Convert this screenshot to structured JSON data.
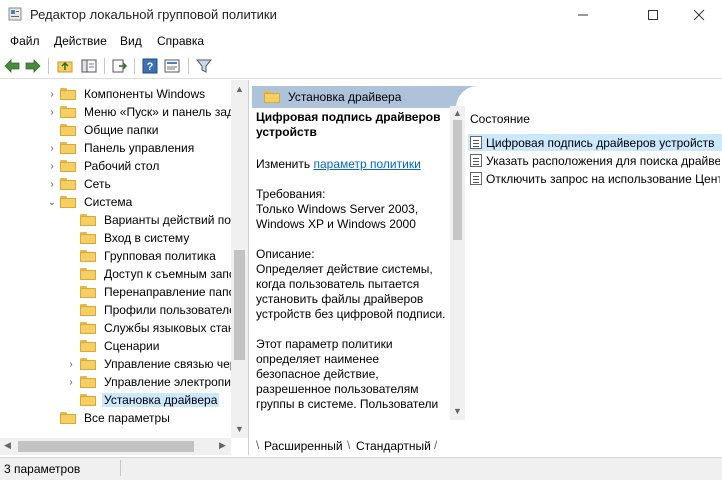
{
  "window": {
    "title": "Редактор локальной групповой политики",
    "controls": [
      "minimize-icon",
      "maximize-icon",
      "close-icon"
    ]
  },
  "menu": [
    "Файл",
    "Действие",
    "Вид",
    "Справка"
  ],
  "toolbar": {
    "icons": [
      "back-arrow-icon",
      "forward-arrow-icon",
      "up-folder-icon",
      "show-hide-tree-icon",
      "export-list-icon",
      "help-icon",
      "properties-icon",
      "filter-icon"
    ]
  },
  "tree": {
    "items": [
      {
        "label": "Компоненты Windows",
        "expander": "›"
      },
      {
        "label": "Меню «Пуск» и панель зад",
        "expander": "›"
      },
      {
        "label": "Общие папки",
        "expander": ""
      },
      {
        "label": "Панель управления",
        "expander": "›"
      },
      {
        "label": "Рабочий стол",
        "expander": "›"
      },
      {
        "label": "Сеть",
        "expander": "›"
      },
      {
        "label": "Система",
        "expander": "⌄"
      },
      {
        "label": "Варианты действий пос",
        "expander": ""
      },
      {
        "label": "Вход в систему",
        "expander": ""
      },
      {
        "label": "Групповая политика",
        "expander": ""
      },
      {
        "label": "Доступ к съемным запс",
        "expander": ""
      },
      {
        "label": "Перенаправление папо",
        "expander": ""
      },
      {
        "label": "Профили пользователе",
        "expander": ""
      },
      {
        "label": "Службы языковых стан",
        "expander": ""
      },
      {
        "label": "Сценарии",
        "expander": ""
      },
      {
        "label": "Управление связью чер",
        "expander": "›"
      },
      {
        "label": "Управление электропит",
        "expander": "›"
      },
      {
        "label": "Установка драйвера",
        "expander": ""
      },
      {
        "label": "Все параметры",
        "expander": ""
      }
    ]
  },
  "right": {
    "header": "Установка драйвера",
    "description": {
      "title": "Цифровая подпись драйверов устройств",
      "edit_prefix": "Изменить ",
      "edit_link": "параметр политики",
      "requirements_label": "Требования:",
      "requirements_text": "Только Windows Server 2003, Windows XP и Windows 2000",
      "description_label": "Описание:",
      "description_text": "Определяет действие системы, когда пользователь пытается установить файлы драйверов устройств без цифровой подписи.",
      "more_text": "Этот параметр политики определяет наименее безопасное действие, разрешенное пользователям группы в системе. Пользователи"
    },
    "list_header": "Состояние",
    "list_items": [
      "Цифровая подпись драйверов устройств",
      "Указать расположения для поиска драйве",
      "Отключить запрос на использование Цент"
    ],
    "tabs": [
      "Расширенный",
      "Стандартный"
    ]
  },
  "status": {
    "text": "3 параметров"
  }
}
